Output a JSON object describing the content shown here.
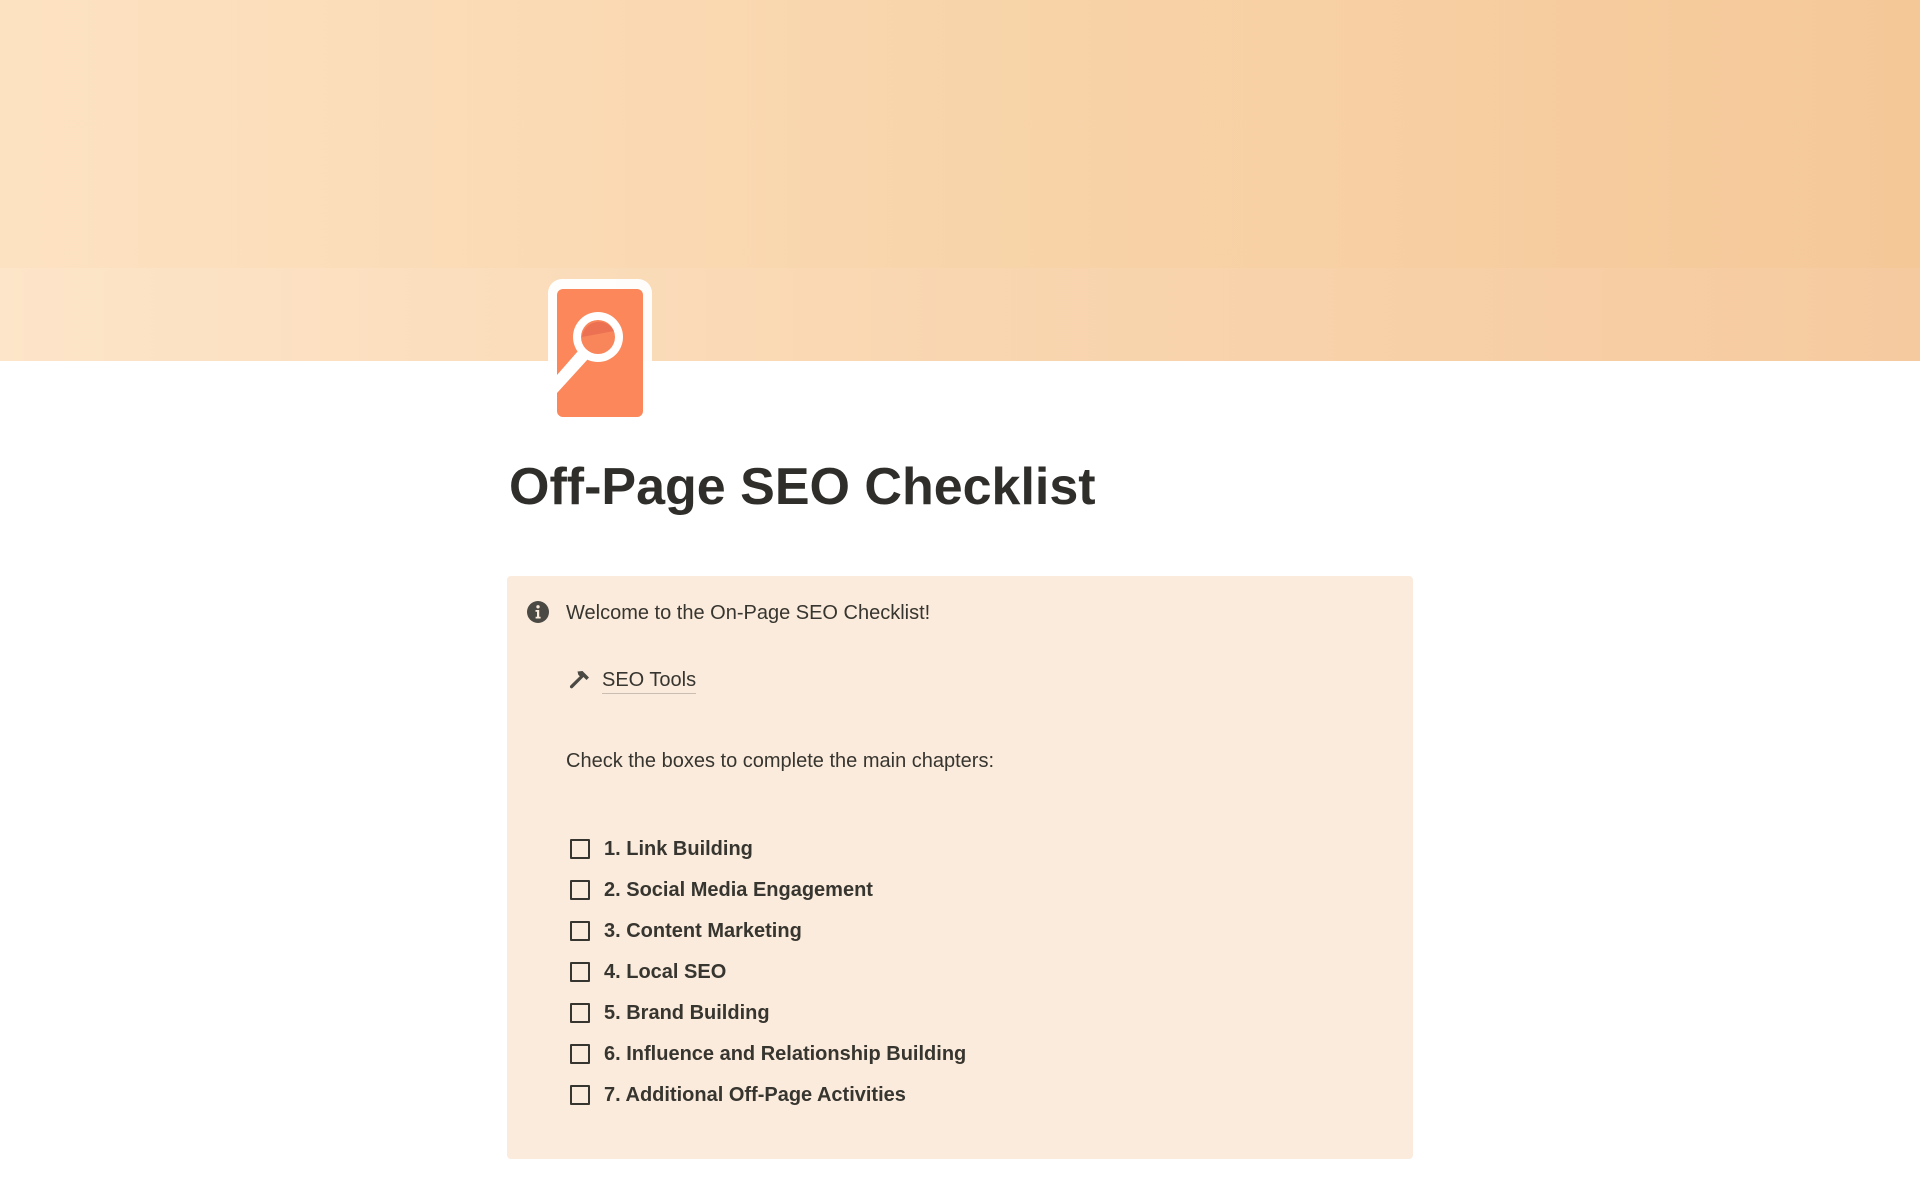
{
  "cover": {
    "colors": {
      "gradient_start": "#fde2c2",
      "gradient_end": "#f5c898"
    }
  },
  "page_icon": {
    "icon": "search-document-icon",
    "color": "#f9855b"
  },
  "page": {
    "title": "Off-Page SEO Checklist"
  },
  "callout": {
    "icon": "info-icon",
    "text": "Welcome to the On-Page SEO Checklist!",
    "background": "#fbebdc",
    "tools_link": {
      "icon": "hammer-icon",
      "label": "SEO Tools"
    },
    "instructions": "Check the boxes to complete the main chapters:",
    "todos": [
      {
        "label": "1. Link Building",
        "checked": false
      },
      {
        "label": "2. Social Media Engagement",
        "checked": false
      },
      {
        "label": "3. Content Marketing",
        "checked": false
      },
      {
        "label": "4. Local SEO",
        "checked": false
      },
      {
        "label": "5. Brand Building",
        "checked": false
      },
      {
        "label": "6. Influence and Relationship Building",
        "checked": false
      },
      {
        "label": "7. Additional Off-Page Activities",
        "checked": false
      }
    ]
  }
}
